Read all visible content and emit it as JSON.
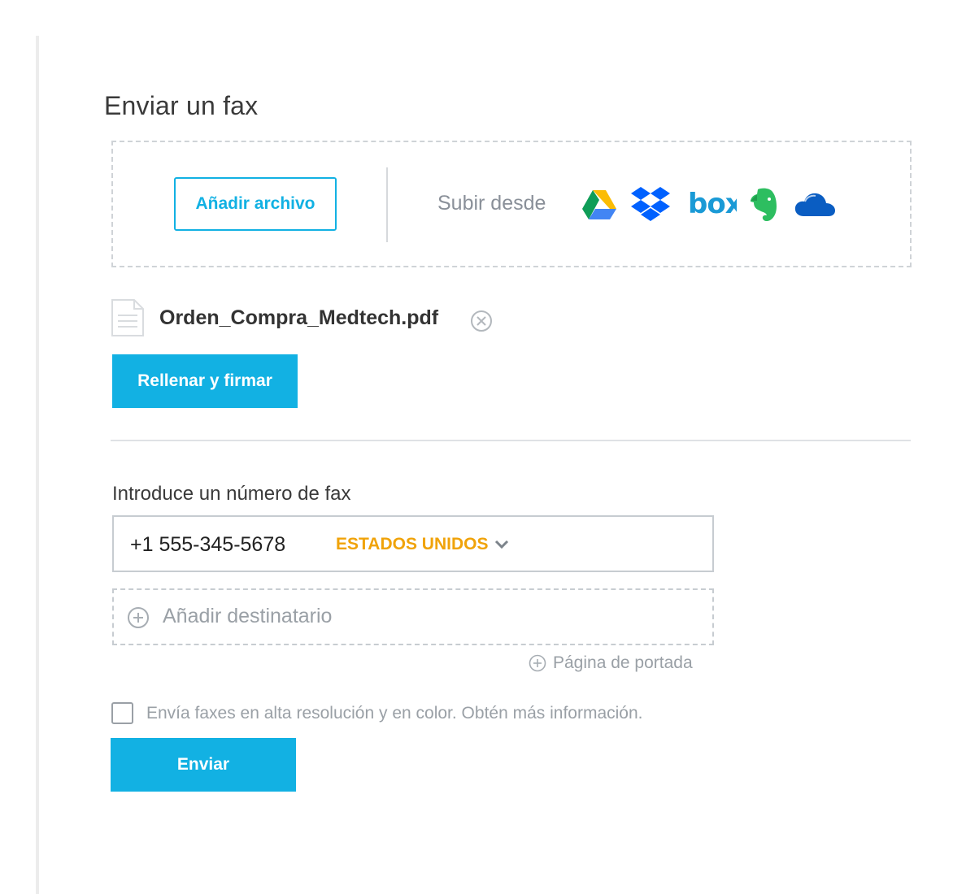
{
  "page": {
    "title": "Enviar un fax"
  },
  "upload": {
    "add_file_label": "Añadir archivo",
    "upload_from_label": "Subir desde",
    "providers": [
      {
        "name": "Google Drive",
        "icon": "google-drive-icon"
      },
      {
        "name": "Dropbox",
        "icon": "dropbox-icon"
      },
      {
        "name": "Box",
        "icon": "box-icon",
        "text": "box"
      },
      {
        "name": "Evernote",
        "icon": "evernote-icon"
      },
      {
        "name": "OneDrive",
        "icon": "onedrive-icon"
      }
    ]
  },
  "attachment": {
    "file_name": "Orden_Compra_Medtech.pdf",
    "fill_sign_label": "Rellenar y firmar"
  },
  "recipient": {
    "label": "Introduce un número de fax",
    "fax_number": "+1 555-345-5678",
    "country": "ESTADOS UNIDOS",
    "add_recipient_label": "Añadir destinatario",
    "cover_page_label": "Página de portada"
  },
  "options": {
    "high_res_text": "Envía faxes en alta resolución y en color. Obtén más información.",
    "high_res_checked": false
  },
  "actions": {
    "send_label": "Enviar"
  },
  "colors": {
    "accent": "#12b1e3",
    "country": "#f0a30a",
    "muted_text": "#9aa0a6",
    "border": "#c7ccd1"
  }
}
